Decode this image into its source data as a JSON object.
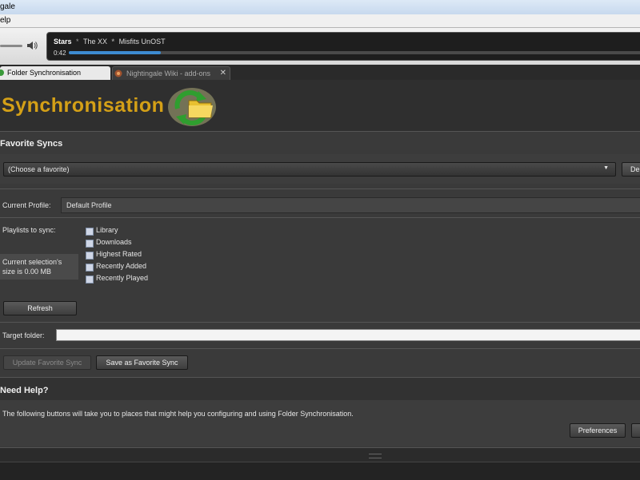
{
  "window": {
    "title_fragment": "gale",
    "menu_fragment": "elp"
  },
  "player": {
    "track_title": "Stars",
    "artist": "The XX",
    "album": "Misfits UnOST",
    "time": "0:42",
    "progress_fraction": 0.16
  },
  "tabs": [
    {
      "label": "Folder Synchronisation",
      "active": true
    },
    {
      "label": "Nightingale Wiki - add-ons",
      "active": false,
      "close": "✕"
    }
  ],
  "header": {
    "title": "Synchronisation"
  },
  "favorites": {
    "section_title": "Favorite Syncs",
    "select_value": "(Choose a favorite)",
    "side_button_fragment": "De"
  },
  "profile": {
    "label": "Current Profile:",
    "value": "Default Profile"
  },
  "playlists": {
    "label": "Playlists to sync:",
    "items": [
      "Library",
      "Downloads",
      "Highest Rated",
      "Recently Added",
      "Recently Played"
    ],
    "size_text_line1": "Current selection's",
    "size_text_line2": "size is 0.00 MB",
    "refresh_label": "Refresh"
  },
  "target": {
    "label": "Target folder:",
    "value": ""
  },
  "actions": {
    "update_label": "Update Favorite Sync",
    "save_label": "Save as Favorite Sync"
  },
  "help": {
    "section_title": "Need Help?",
    "description": "The following buttons will take you to places that might help you configuring and using Folder Synchronisation.",
    "preferences_label": "Preferences"
  },
  "colors": {
    "accent_heading": "#d4a017",
    "progress": "#3d8bd1"
  }
}
